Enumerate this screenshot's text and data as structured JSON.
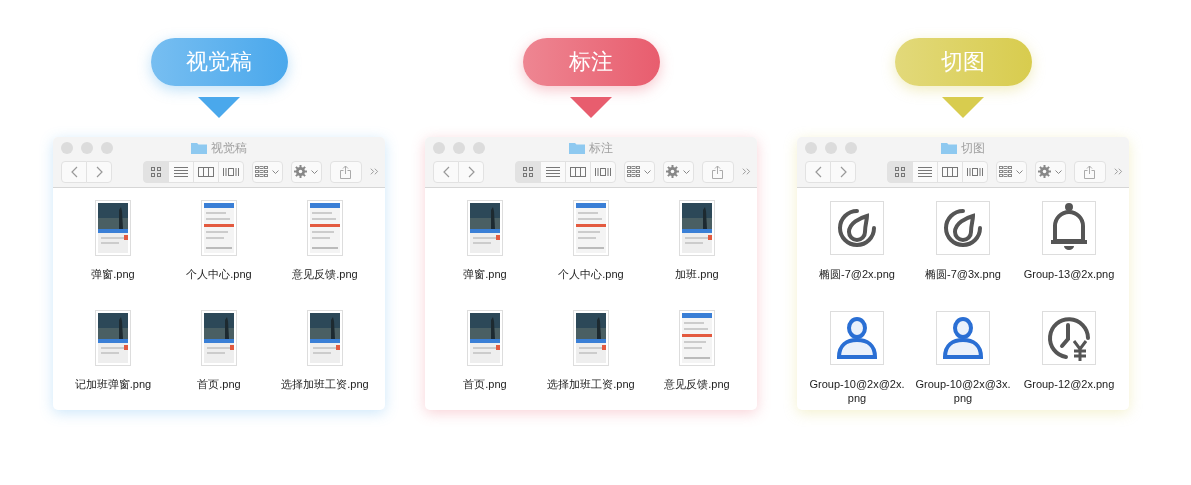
{
  "panels": [
    {
      "label": "视觉稿",
      "color": "#4aa8ec",
      "window": {
        "title": "视觉稿",
        "views": [
          {
            "kind": "icons",
            "selected": true
          },
          {
            "kind": "list",
            "selected": false
          },
          {
            "kind": "columns",
            "selected": false
          },
          {
            "kind": "coverflow",
            "selected": false
          }
        ],
        "files": [
          {
            "name": "弹窗.png",
            "kind": "photo"
          },
          {
            "name": "个人中心.png",
            "kind": "form"
          },
          {
            "name": "意见反馈.png",
            "kind": "form"
          },
          {
            "name": "记加班弹窗.png",
            "kind": "photo"
          },
          {
            "name": "首页.png",
            "kind": "photo"
          },
          {
            "name": "选择加班工资.png",
            "kind": "photo"
          }
        ]
      }
    },
    {
      "label": "标注",
      "color": "#e85d6e",
      "window": {
        "title": "标注",
        "views": [
          {
            "kind": "icons",
            "selected": true
          },
          {
            "kind": "list",
            "selected": false
          },
          {
            "kind": "columns",
            "selected": false
          },
          {
            "kind": "coverflow",
            "selected": false
          }
        ],
        "files": [
          {
            "name": "弹窗.png",
            "kind": "photo"
          },
          {
            "name": "个人中心.png",
            "kind": "form"
          },
          {
            "name": "加班.png",
            "kind": "photo"
          },
          {
            "name": "首页.png",
            "kind": "photo"
          },
          {
            "name": "选择加班工资.png",
            "kind": "photo"
          },
          {
            "name": "意见反馈.png",
            "kind": "form"
          }
        ]
      }
    },
    {
      "label": "切图",
      "color": "#d8cc4e",
      "window": {
        "title": "切图",
        "views": [
          {
            "kind": "icons",
            "selected": true
          },
          {
            "kind": "list",
            "selected": false
          },
          {
            "kind": "columns",
            "selected": false
          },
          {
            "kind": "coverflow",
            "selected": false
          }
        ],
        "files": [
          {
            "name": "椭圆-7@2x.png",
            "kind": "drop"
          },
          {
            "name": "椭圆-7@3x.png",
            "kind": "drop"
          },
          {
            "name": "Group-13@2x.png",
            "kind": "bell"
          },
          {
            "name": "Group-10@2x@2x.png",
            "kind": "person"
          },
          {
            "name": "Group-10@2x@3x.png",
            "kind": "person"
          },
          {
            "name": "Group-12@2x.png",
            "kind": "clock-yen"
          }
        ]
      }
    }
  ]
}
